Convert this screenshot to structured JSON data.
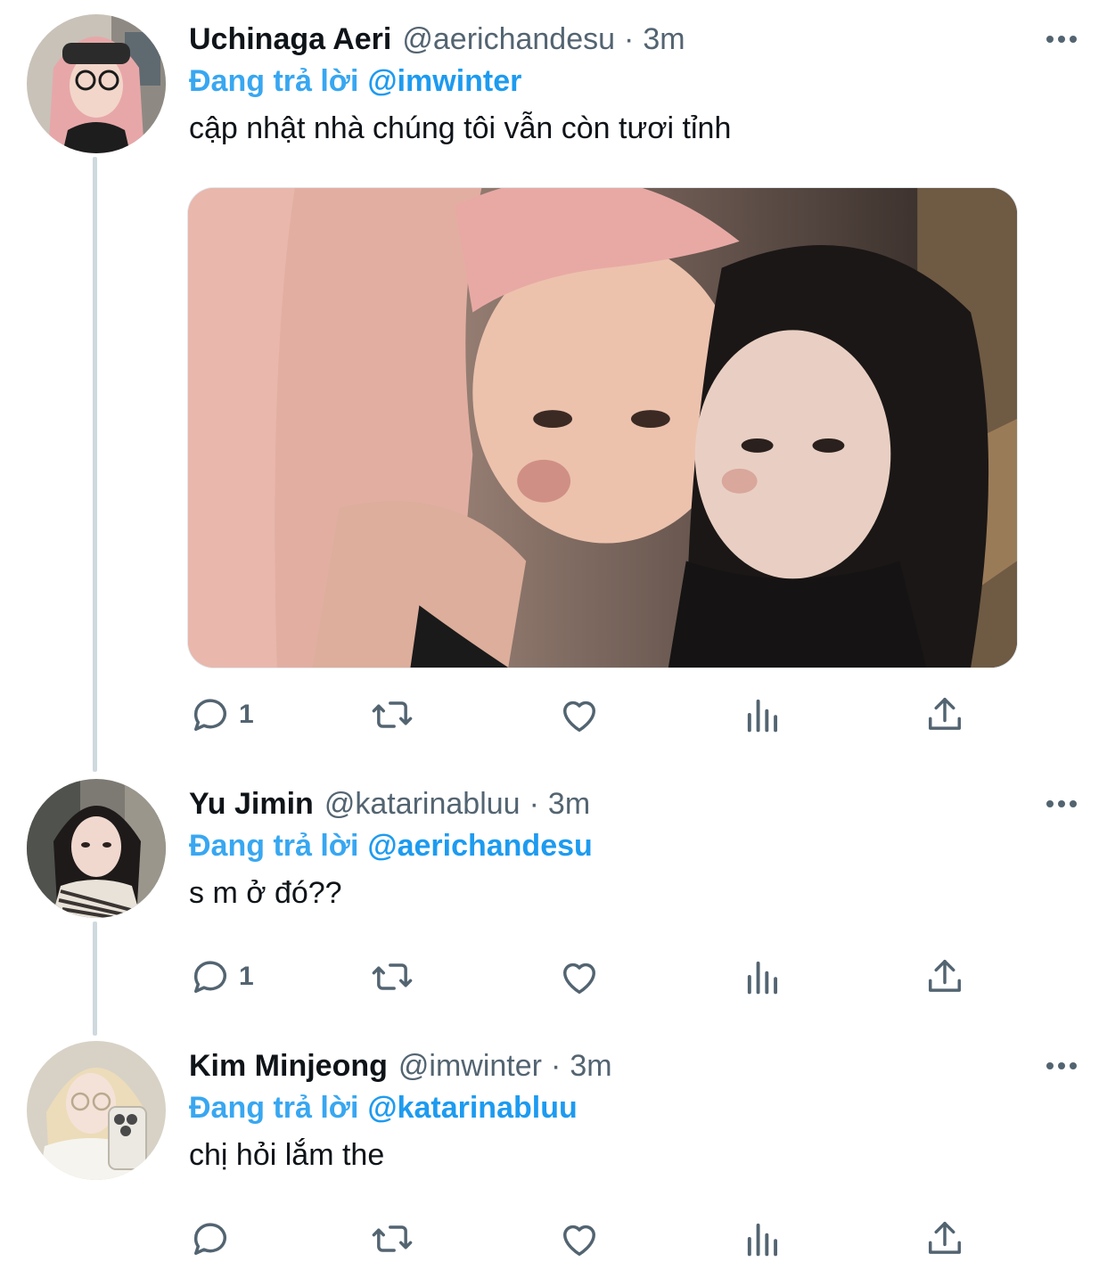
{
  "tweets": [
    {
      "display_name": "Uchinaga Aeri",
      "handle": "@aerichandesu",
      "separator": "·",
      "time": "3m",
      "reply_prefix": "Đang trả lời",
      "reply_to": "@imwinter",
      "text": "cập nhật nhà chúng tôi vẫn còn tươi tỉnh",
      "has_media": true,
      "reply_count": "1"
    },
    {
      "display_name": "Yu Jimin",
      "handle": "@katarinabluu",
      "separator": "·",
      "time": "3m",
      "reply_prefix": "Đang trả lời",
      "reply_to": "@aerichandesu",
      "text": "s m ở đó??",
      "has_media": false,
      "reply_count": "1"
    },
    {
      "display_name": "Kim Minjeong",
      "handle": "@imwinter",
      "separator": "·",
      "time": "3m",
      "reply_prefix": "Đang trả lời",
      "reply_to": "@katarinabluu",
      "text": "chị hỏi lắm the",
      "has_media": false,
      "reply_count": ""
    }
  ],
  "icons": {
    "reply": "speech-bubble-icon",
    "retweet": "retweet-arrows-icon",
    "like": "heart-outline-icon",
    "views": "bar-chart-icon",
    "share": "share-upload-icon",
    "more": "ellipsis-icon"
  },
  "colors": {
    "accent": "#1d9bf0",
    "secondary_text": "#536471",
    "primary_text": "#0f1419",
    "thread_line": "#cfd9de"
  }
}
